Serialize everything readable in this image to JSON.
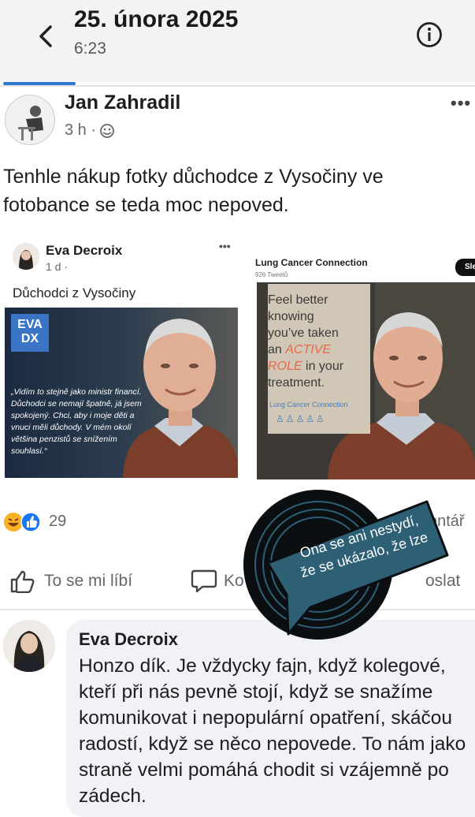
{
  "header": {
    "date": "25. února 2025",
    "time": "6:23"
  },
  "post": {
    "author": "Jan Zahradil",
    "time": "3 h ·",
    "text": "Tenhle nákup fotky důchodce z Vysočiny ve fotobance se teda moc nepoved."
  },
  "card1": {
    "author": "Eva Decroix",
    "meta": "1 d ·",
    "title": "Důchodci z Vysočiny",
    "logo_line1": "EVA",
    "logo_line2": "DX",
    "quote": "„Vidím to stejně jako ministr financí. Důchodci se nemají špatně, já jsem spokojený. Chci, aby i moje děti a vnuci měli důchody. V mém okolí většina penzistů se snížením souhlasí.“"
  },
  "card2": {
    "org": "Lung Cancer Connection",
    "tweets": "926 Tweetů",
    "button": "Sle",
    "panel_lines": [
      "Feel better",
      "knowing",
      "you’ve taken"
    ],
    "panel_an": "an ",
    "panel_active": "ACTIVE",
    "panel_role": "ROLE",
    "panel_in_your": " in your",
    "panel_treatment": "treatment.",
    "panel_sub": "Lung Cancer Connection"
  },
  "reactions": {
    "count": "29",
    "comments": "entář"
  },
  "actions": {
    "like": "To se mi líbí",
    "comment": "Ko",
    "share": "oslat"
  },
  "comment": {
    "author": "Eva Decroix",
    "text": "Honzo dík. Je vždycky fajn, když kolegové, kteří při nás pevně stojí, když se snažíme komunikovat i nepopulární opatření, skáčou radostí, když se něco nepovede. To nám jako straně velmi pomáhá chodit si vzájemně po zádech."
  },
  "sticker": {
    "line1": "Ona se ani nestydí,",
    "line2": "že se ukázalo, že lze"
  },
  "colors": {
    "accent": "#2d7ad0",
    "sticker_bg": "#2e6075",
    "sticker_ring": "#0b0f12"
  }
}
